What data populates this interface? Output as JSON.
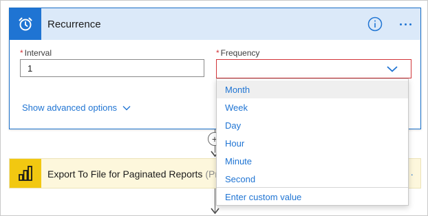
{
  "recurrence": {
    "title": "Recurrence",
    "icon": "alarm-clock-icon",
    "accent": "#1f74d3",
    "header_bg": "#dbe9f9",
    "interval": {
      "required_mark": "*",
      "label": "Interval",
      "value": "1"
    },
    "frequency": {
      "required_mark": "*",
      "label": "Frequency",
      "value": ""
    },
    "advanced_label": "Show advanced options"
  },
  "connector": {
    "add_symbol": "+"
  },
  "export": {
    "title": "Export To File for Paginated Reports",
    "suffix": "(Pre",
    "icon": "power-bi-icon",
    "icon_bg": "#f2c811",
    "more": "·"
  },
  "dropdown": {
    "options": [
      "Month",
      "Week",
      "Day",
      "Hour",
      "Minute",
      "Second"
    ],
    "highlighted": "Month",
    "custom_label": "Enter custom value"
  }
}
